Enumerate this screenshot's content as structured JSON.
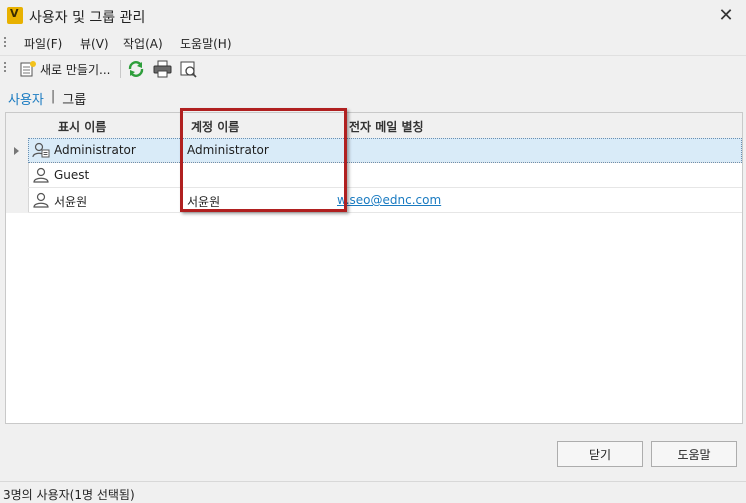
{
  "window": {
    "title": "사용자 및 그룹 관리",
    "close_glyph": "✕"
  },
  "menu": {
    "items": [
      "파일(F)",
      "뷰(V)",
      "작업(A)",
      "도움말(H)"
    ]
  },
  "toolbar": {
    "new_label": "새로 만들기..."
  },
  "view_tabs": {
    "users": "사용자",
    "separator": "|",
    "groups": "그룹"
  },
  "grid": {
    "columns": [
      "표시 이름",
      "계정 이름",
      "전자 메일 별칭"
    ],
    "rows": [
      {
        "display_name": "Administrator",
        "account_name": "Administrator",
        "email": "",
        "selected": true,
        "icon": "admin-user-icon"
      },
      {
        "display_name": "Guest",
        "account_name": "",
        "email": "",
        "selected": false,
        "icon": "user-icon"
      },
      {
        "display_name": "서윤원",
        "account_name": "서윤원",
        "email": "w.seo@ednc.com",
        "selected": false,
        "icon": "user-icon"
      }
    ]
  },
  "buttons": {
    "close": "닫기",
    "help": "도움말"
  },
  "status": {
    "text": "3명의 사용자(1명 선택됨)"
  },
  "colors": {
    "link": "#1a7bc1",
    "highlight": "#b02020",
    "selection": "#d9ebf8"
  }
}
